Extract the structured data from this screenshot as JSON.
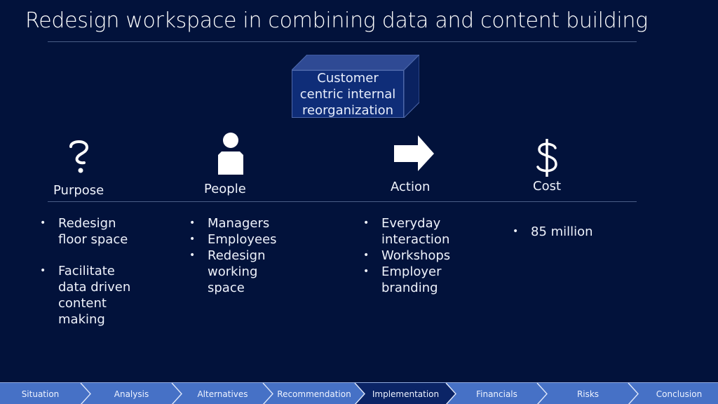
{
  "slide": {
    "title": "Redesign workspace in combining data and content building",
    "center_box": {
      "lines": [
        "Customer",
        "centric internal",
        "reorganization"
      ]
    },
    "columns": [
      {
        "icon": "question-mark-icon",
        "label": "Purpose",
        "bullets": [
          {
            "text_lines": [
              "Redesign",
              "floor space"
            ]
          },
          {
            "text_lines": [
              "Facilitate",
              "data driven",
              "content",
              "making"
            ]
          }
        ]
      },
      {
        "icon": "person-icon",
        "label": "People",
        "bullets": [
          {
            "text_lines": [
              "Managers"
            ]
          },
          {
            "text_lines": [
              "Employees"
            ]
          },
          {
            "text_lines": [
              "Redesign",
              "working",
              "space"
            ]
          }
        ]
      },
      {
        "icon": "arrow-right-icon",
        "label": "Action",
        "bullets": [
          {
            "text_lines": [
              "Everyday",
              "interaction"
            ]
          },
          {
            "text_lines": [
              "Workshops"
            ]
          },
          {
            "text_lines": [
              "Employer",
              "branding"
            ]
          }
        ]
      },
      {
        "icon": "dollar-icon",
        "label": "Cost",
        "bullets": [
          {
            "text_lines": [
              "85 million"
            ]
          }
        ]
      }
    ]
  },
  "navigation": {
    "steps": [
      {
        "label": "Situation",
        "active": false
      },
      {
        "label": "Analysis",
        "active": false
      },
      {
        "label": "Alternatives",
        "active": false
      },
      {
        "label": "Recommendation",
        "active": false
      },
      {
        "label": "Implementation",
        "active": true
      },
      {
        "label": "Financials",
        "active": false
      },
      {
        "label": "Risks",
        "active": false
      },
      {
        "label": "Conclusion",
        "active": false
      }
    ]
  },
  "colors": {
    "background": "#02123b",
    "nav_bar": "#4671c6",
    "nav_active": "#0b2466",
    "box_front": "#0f2d78",
    "box_top": "#2f4a94",
    "box_side": "#0a2260"
  }
}
